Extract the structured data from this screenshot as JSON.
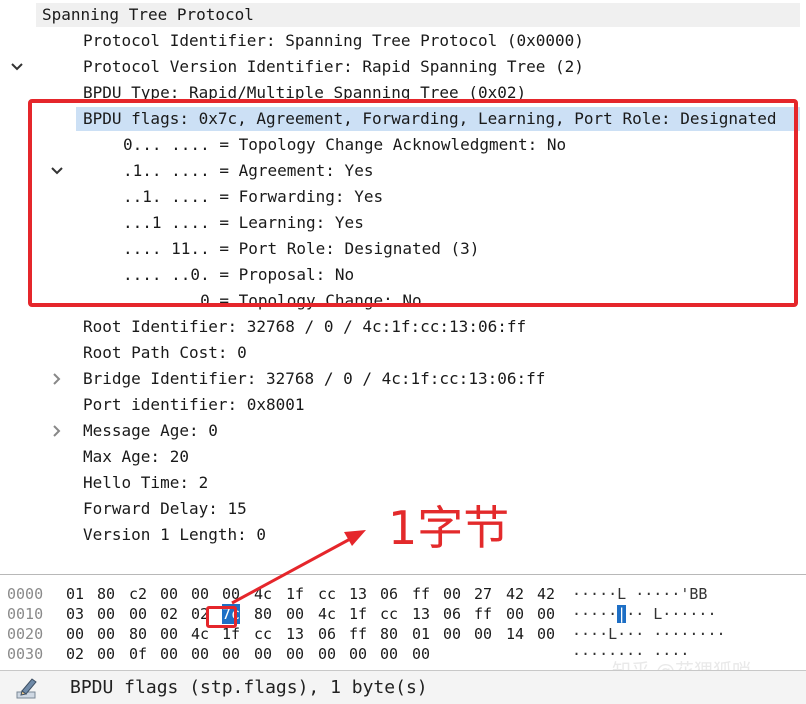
{
  "colors": {
    "accent_red": "#e5262b",
    "selection_blue": "#cce0f5",
    "hex_select": "#1e6fc5"
  },
  "tree": {
    "root": "Spanning Tree Protocol",
    "protocol_identifier": "Protocol Identifier: Spanning Tree Protocol (0x0000)",
    "protocol_version": "Protocol Version Identifier: Rapid Spanning Tree (2)",
    "bpdu_type": "BPDU Type: Rapid/Multiple Spanning Tree (0x02)",
    "bpdu_flags": "BPDU flags: 0x7c, Agreement, Forwarding, Learning, Port Role: Designated",
    "flags": [
      "0... .... = Topology Change Acknowledgment: No",
      ".1.. .... = Agreement: Yes",
      "..1. .... = Forwarding: Yes",
      "...1 .... = Learning: Yes",
      ".... 11.. = Port Role: Designated (3)",
      ".... ..0. = Proposal: No",
      ".... ...0 = Topology Change: No"
    ],
    "root_identifier": "Root Identifier: 32768 / 0 / 4c:1f:cc:13:06:ff",
    "root_path_cost": "Root Path Cost: 0",
    "bridge_identifier": "Bridge Identifier: 32768 / 0 / 4c:1f:cc:13:06:ff",
    "port_identifier": "Port identifier: 0x8001",
    "message_age": "Message Age: 0",
    "max_age": "Max Age: 20",
    "hello_time": "Hello Time: 2",
    "forward_delay": "Forward Delay: 15",
    "version1_length": "Version 1 Length: 0"
  },
  "annotation": {
    "text": "1字节"
  },
  "hex": {
    "rows": [
      {
        "offset": "0000",
        "bytes": [
          "01",
          "80",
          "c2",
          "00",
          "00",
          "00",
          "4c",
          "1f",
          "cc",
          "13",
          "06",
          "ff",
          "00",
          "27",
          "42",
          "42"
        ],
        "ascii": "·····L ·····'BB"
      },
      {
        "offset": "0010",
        "bytes": [
          "03",
          "00",
          "00",
          "02",
          "02",
          "7c",
          "80",
          "00",
          "4c",
          "1f",
          "cc",
          "13",
          "06",
          "ff",
          "00",
          "00"
        ],
        "ascii_pre": "·····",
        "ascii_sel": "|",
        "ascii_post": "·· L······"
      },
      {
        "offset": "0020",
        "bytes": [
          "00",
          "00",
          "80",
          "00",
          "4c",
          "1f",
          "cc",
          "13",
          "06",
          "ff",
          "80",
          "01",
          "00",
          "00",
          "14",
          "00"
        ],
        "ascii": "····L··· ········"
      },
      {
        "offset": "0030",
        "bytes": [
          "02",
          "00",
          "0f",
          "00",
          "00",
          "00",
          "00",
          "00",
          "00",
          "00",
          "00",
          "00"
        ],
        "ascii": "········ ····"
      }
    ]
  },
  "status": {
    "text": "BPDU flags (stp.flags), 1 byte(s)",
    "icon": "edit-pencil-icon"
  },
  "watermark": {
    "text": "知乎 @花狸狐哨"
  }
}
